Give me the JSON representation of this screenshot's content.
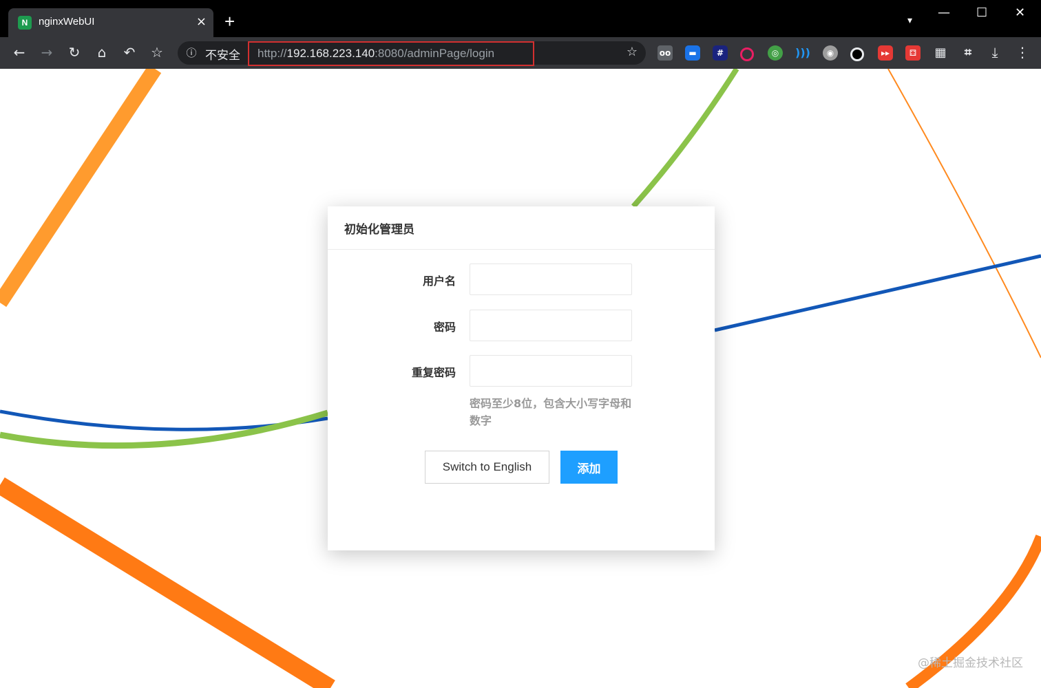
{
  "browser": {
    "tab_title": "nginxWebUI",
    "tab_favicon_letter": "N",
    "tab_close": "×",
    "new_tab": "+",
    "window_controls": {
      "minimize": "—",
      "maximize": "☐",
      "close": "✕",
      "tab_menu": "▾"
    },
    "nav": {
      "back": "←",
      "forward": "→",
      "reload": "↻",
      "home": "⌂",
      "undo": "↶",
      "bookmark": "☆"
    },
    "security_label": "不安全",
    "url_scheme": "http://",
    "url_host": "192.168.223.140",
    "url_path": ":8080/adminPage/login",
    "bookmark_star": "☆",
    "menu": "⋮",
    "download": "⤓",
    "crop": "⌗",
    "accent_red": "#d32f2f"
  },
  "dialog": {
    "title": "初始化管理员",
    "fields": [
      {
        "label": "用户名",
        "value": "",
        "placeholder": ""
      },
      {
        "label": "密码",
        "value": "",
        "placeholder": ""
      },
      {
        "label": "重复密码",
        "value": "",
        "placeholder": ""
      }
    ],
    "hint": "密码至少8位，包含大小写字母和数字",
    "buttons": {
      "switch_language": "Switch to English",
      "submit": "添加"
    },
    "submit_color": "#1e9fff"
  },
  "watermark": "@稀土掘金技术社区"
}
